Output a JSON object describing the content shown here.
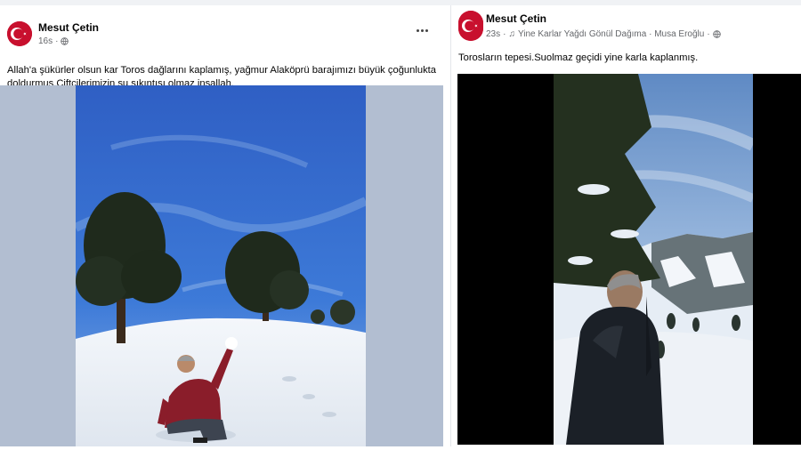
{
  "left_post": {
    "author": "Mesut Çetin",
    "time": "16s",
    "caption": "Allah'a şükürler olsun kar Toros dağlarını kaplamış, yağmur Alaköprü barajımızı büyük çoğunlukta doldurmuş.Çiftçilerimizin su sıkıntısı olmaz inşallah.",
    "privacy_icon": "globe-icon",
    "menu_icon": "more-options-icon"
  },
  "right_post": {
    "author": "Mesut Çetin",
    "time": "23s",
    "separator": "·",
    "music_icon": "music-note-icon",
    "music": "Yine Karlar Yağdı Gönül Dağıma · Musa Eroğlu",
    "privacy_icon": "globe-icon",
    "caption": "Torosların tepesi.Suolmaz geçidi yine karla kaplanmış."
  },
  "colors": {
    "brand_red": "#c8102e",
    "feed_bg": "#f0f2f5",
    "meta_text": "#65676b"
  }
}
